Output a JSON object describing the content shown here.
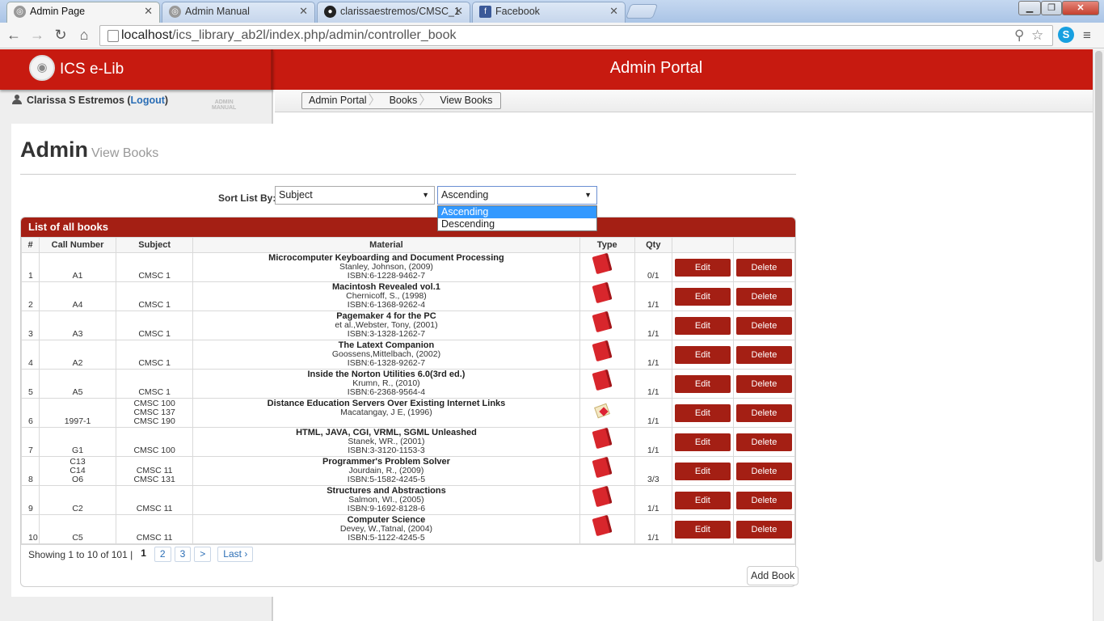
{
  "tabs": [
    {
      "title": "Admin Page",
      "icon": "site-icon",
      "active": true
    },
    {
      "title": "Admin Manual",
      "icon": "site-icon"
    },
    {
      "title": "clarissaestremos/CMSC_1",
      "icon": "github-icon"
    },
    {
      "title": "Facebook",
      "icon": "facebook-icon"
    }
  ],
  "address": {
    "host": "localhost",
    "path": "/ics_library_ab2l/index.php/admin/controller_book"
  },
  "header": {
    "brand": "ICS e-Lib",
    "portal_title": "Admin Portal"
  },
  "user": {
    "name": "Clarissa S Estremos",
    "open_paren": " (",
    "logout": "Logout",
    "close_paren": ")",
    "manual_label_1": "ADMIN",
    "manual_label_2": "MANUAL"
  },
  "breadcrumb": [
    "Admin Portal",
    "Books",
    "View Books"
  ],
  "page": {
    "title": "Admin",
    "subtitle": "View Books"
  },
  "sort": {
    "label": "Sort List By:",
    "field": "Subject",
    "order": "Ascending",
    "options": [
      "Ascending",
      "Descending"
    ]
  },
  "panel": {
    "title": "List of all books"
  },
  "table": {
    "headers": [
      "#",
      "Call Number",
      "Subject",
      "Material",
      "Type",
      "Qty",
      "",
      ""
    ],
    "rows": [
      {
        "num": "1",
        "call": [
          "A1"
        ],
        "subject": [
          "CMSC 1"
        ],
        "title": "Microcomputer Keyboarding and Document Processing",
        "author": "Stanley, Johnson, (2009)",
        "isbn": "ISBN:6-1228-9462-7",
        "type": "book",
        "qty": "0/1"
      },
      {
        "num": "2",
        "call": [
          "A4"
        ],
        "subject": [
          "CMSC 1"
        ],
        "title": "Macintosh Revealed vol.1",
        "author": "Chernicoff, S., (1998)",
        "isbn": "ISBN:6-1368-9262-4",
        "type": "book",
        "qty": "1/1"
      },
      {
        "num": "3",
        "call": [
          "A3"
        ],
        "subject": [
          "CMSC 1"
        ],
        "title": "Pagemaker 4 for the PC",
        "author": "et al.,Webster, Tony, (2001)",
        "isbn": "ISBN:3-1328-1262-7",
        "type": "book",
        "qty": "1/1"
      },
      {
        "num": "4",
        "call": [
          "A2"
        ],
        "subject": [
          "CMSC 1"
        ],
        "title": "The Latext Companion",
        "author": "Goossens,Mittelbach, (2002)",
        "isbn": "ISBN:6-1328-9262-7",
        "type": "book",
        "qty": "1/1"
      },
      {
        "num": "5",
        "call": [
          "A5"
        ],
        "subject": [
          "CMSC 1"
        ],
        "title": "Inside the Norton Utilities 6.0(3rd ed.)",
        "author": "Krumn, R., (2010)",
        "isbn": "ISBN:6-2368-9564-4",
        "type": "book",
        "qty": "1/1"
      },
      {
        "num": "6",
        "call": [
          "1997-1"
        ],
        "subject": [
          "CMSC 100",
          "CMSC 137",
          "CMSC 190"
        ],
        "title": "Distance Education Servers Over Existing Internet Links",
        "author": "Macatangay, J E, (1996)",
        "isbn": "",
        "type": "thesis",
        "qty": "1/1"
      },
      {
        "num": "7",
        "call": [
          "G1"
        ],
        "subject": [
          "CMSC 100"
        ],
        "title": "HTML, JAVA, CGI, VRML, SGML Unleashed",
        "author": "Stanek, WR., (2001)",
        "isbn": "ISBN:3-3120-1153-3",
        "type": "book",
        "qty": "1/1"
      },
      {
        "num": "8",
        "call": [
          "C13",
          "C14",
          "O6"
        ],
        "subject": [
          "CMSC 11",
          "CMSC 131"
        ],
        "title": "Programmer's Problem Solver",
        "author": "Jourdain, R., (2009)",
        "isbn": "ISBN:5-1582-4245-5",
        "type": "book",
        "qty": "3/3"
      },
      {
        "num": "9",
        "call": [
          "C2"
        ],
        "subject": [
          "CMSC 11"
        ],
        "title": "Structures and Abstractions",
        "author": "Salmon, WI., (2005)",
        "isbn": "ISBN:9-1692-8128-6",
        "type": "book",
        "qty": "1/1"
      },
      {
        "num": "10",
        "call": [
          "C5"
        ],
        "subject": [
          "CMSC 11"
        ],
        "title": "Computer Science",
        "author": "Devey, W.,Tatnal, (2004)",
        "isbn": "ISBN:5-1122-4245-5",
        "type": "book",
        "qty": "1/1"
      }
    ],
    "edit_label": "Edit",
    "delete_label": "Delete"
  },
  "pagination": {
    "summary": "Showing 1 to 10 of 101 |",
    "pages": [
      "1",
      "2",
      "3"
    ],
    "next": ">",
    "last": "Last ›"
  },
  "add_book_label": "Add Book",
  "colors": {
    "header_red": "#c71a10",
    "panel_red": "#a41f14",
    "button_red": "#a41f14",
    "link_blue": "#2a6db5"
  }
}
